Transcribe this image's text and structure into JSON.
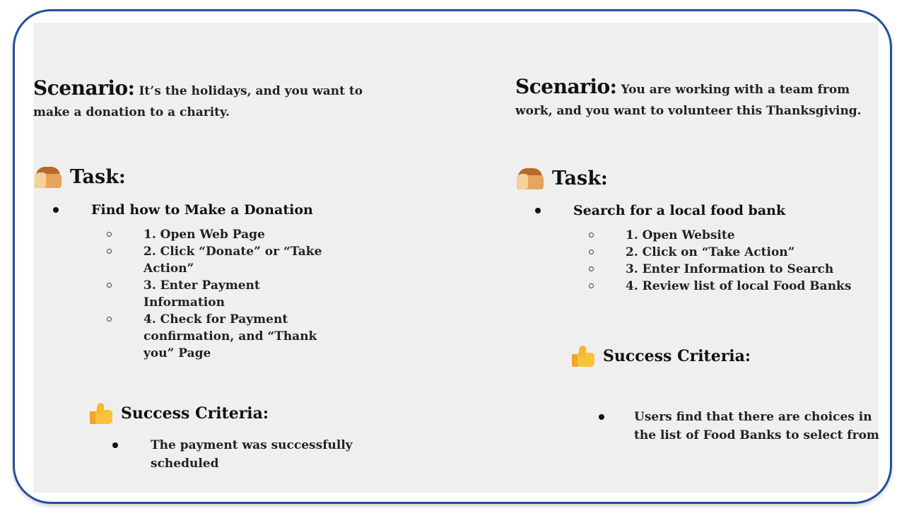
{
  "left": {
    "scenario_label": "Scenario:",
    "scenario_text": "It’s the holidays, and you want to make a donation to a charity.",
    "task_heading": "Task:",
    "task_title": "Find how to Make a Donation",
    "steps": [
      "1. Open Web Page",
      "2. Click “Donate” or “Take Action”",
      "3. Enter Payment Information",
      "4. Check for Payment confirmation, and “Thank you” Page"
    ],
    "success_heading": "Success Criteria:",
    "criteria": [
      "The payment was successfully scheduled"
    ]
  },
  "right": {
    "scenario_label": "Scenario:",
    "scenario_text": "You are working with a team from work, and you want to volunteer this Thanksgiving.",
    "task_heading": "Task:",
    "task_title": "Search for a local food bank",
    "steps": [
      "1. Open Website",
      "2. Click on “Take Action”",
      "3. Enter Information to Search",
      "4. Review list of local Food Banks"
    ],
    "success_heading": "Success Criteria:",
    "criteria": [
      "Users find that there are choices in the list of Food Banks to select from"
    ]
  },
  "icons": {
    "task_icon": "bread-icon",
    "success_icon": "thumbs-up-icon"
  },
  "colors": {
    "border": "#24509a",
    "panel_background": "#efefef"
  }
}
